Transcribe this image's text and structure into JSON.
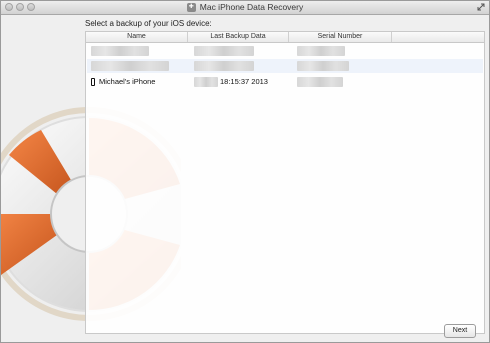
{
  "window": {
    "title": "Mac iPhone Data Recovery"
  },
  "main": {
    "prompt": "Select a backup of your iOS device:",
    "columns": [
      "Name",
      "Last Backup Data",
      "Serial Number"
    ],
    "rows": [
      {
        "name": "",
        "date": "",
        "serial": ""
      },
      {
        "name": "",
        "date": "",
        "serial": ""
      },
      {
        "name": "Michael's iPhone",
        "date": "18:15:37 2013",
        "serial": ""
      }
    ]
  },
  "actions": {
    "next_label": "Next"
  },
  "icons": {
    "close": "window-close-icon",
    "minimize": "window-minimize-icon",
    "zoom": "window-zoom-icon",
    "fullscreen": "fullscreen-icon",
    "app": "app-icon",
    "phone": "phone-icon",
    "illustration": "lifebuoy-illustration"
  },
  "colors": {
    "accent_orange": "#e8672a",
    "selection_blue": "#eef3fb"
  }
}
